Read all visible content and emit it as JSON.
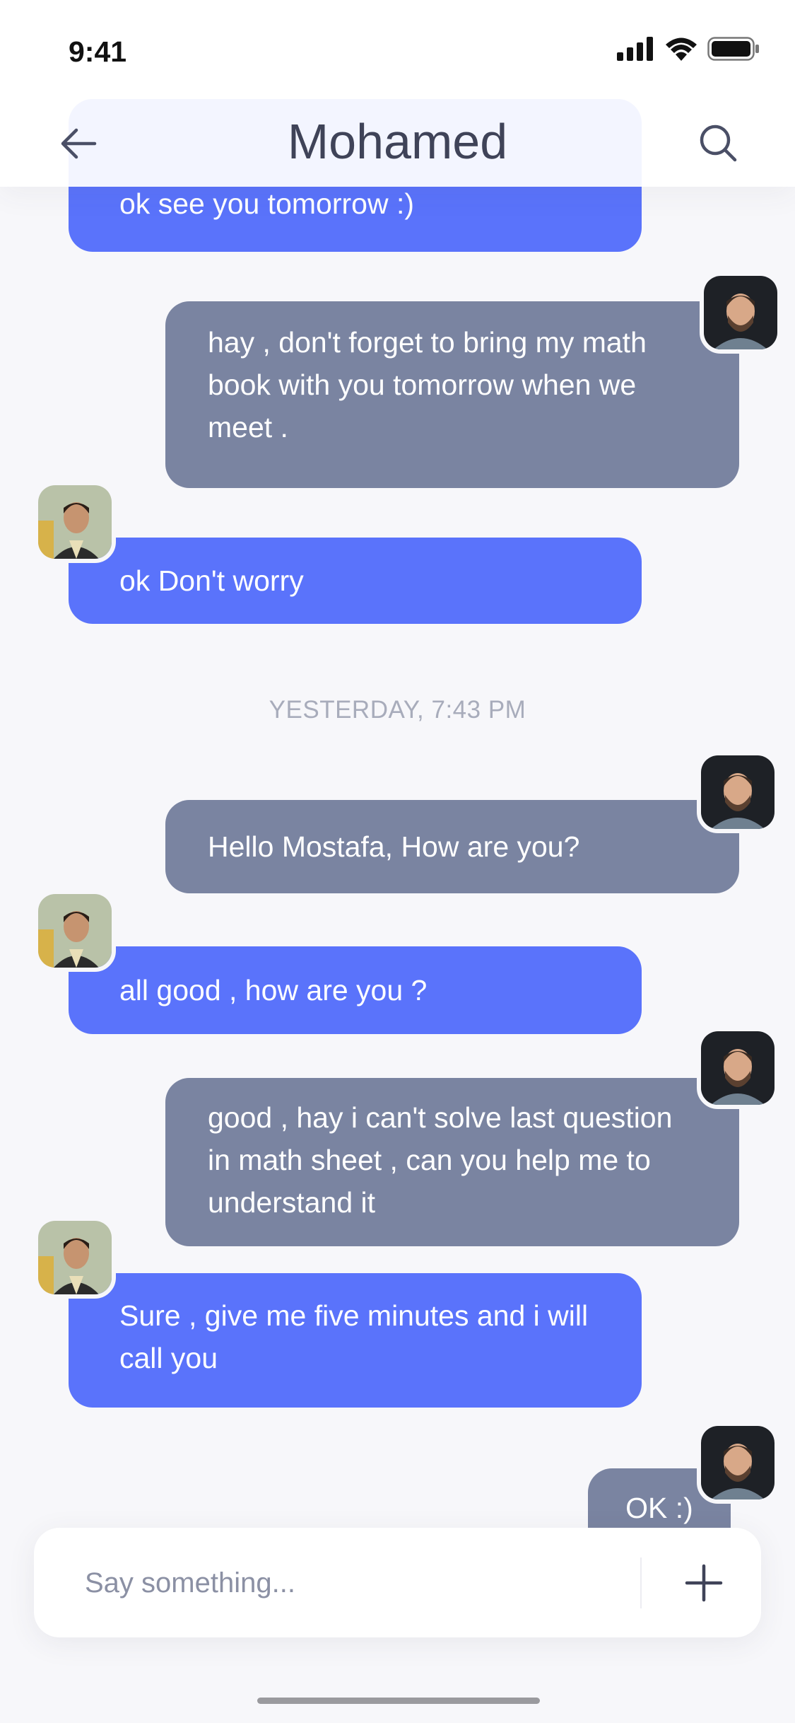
{
  "status": {
    "time": "9:41"
  },
  "header": {
    "title": "Mohamed"
  },
  "timestamp": "YESTERDAY, 7:43 PM",
  "messages": [
    {
      "from": "in",
      "text": "ok see you tomorrow :)"
    },
    {
      "from": "out",
      "text": "hay , don't forget to bring my math book with you tomorrow when we meet ."
    },
    {
      "from": "in",
      "text": "ok Don't worry"
    },
    {
      "from": "out",
      "text": "Hello Mostafa, How are you?"
    },
    {
      "from": "in",
      "text": "all good , how are you ?"
    },
    {
      "from": "out",
      "text": "good , hay i can't solve last question in math sheet , can you help me to understand it"
    },
    {
      "from": "in",
      "text": "Sure , give me five minutes and i will call you"
    },
    {
      "from": "out",
      "text": "OK :)"
    }
  ],
  "composer": {
    "placeholder": "Say something..."
  },
  "icons": {
    "back": "back-arrow-icon",
    "search": "search-icon",
    "add": "plus-icon",
    "signal": "cellular-signal-icon",
    "wifi": "wifi-icon",
    "battery": "battery-icon"
  },
  "colors": {
    "incoming_bubble": "#5a73fb",
    "outgoing_bubble": "#7a84a1",
    "background": "#f7f7fa",
    "title": "#3f4358"
  }
}
